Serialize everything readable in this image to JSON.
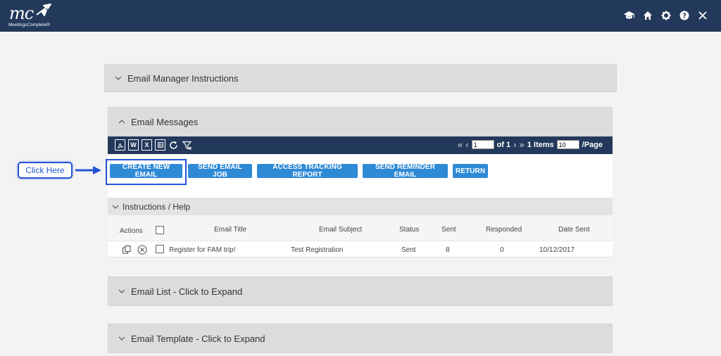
{
  "brand": {
    "logo_text": "mc",
    "logo_subtitle": "MeetingsComplete®"
  },
  "topbar_icons": [
    "graduation-cap-icon",
    "home-icon",
    "gear-icon",
    "help-icon",
    "close-icon"
  ],
  "colors": {
    "header_bg": "#23395b",
    "button_blue": "#2f8ad6",
    "callout_blue": "#2453d6",
    "panel_grey": "#dcdcdc"
  },
  "panels": {
    "instructions": "Email Manager Instructions",
    "messages": "Email Messages",
    "email_list": "Email List - Click to Expand",
    "template": "Email Template - Click to Expand",
    "help": "Instructions / Help"
  },
  "toolbar": {
    "icons": [
      "pdf-icon",
      "word-icon",
      "excel-icon",
      "csv-icon",
      "refresh-icon",
      "clear-filter-icon"
    ],
    "pager": {
      "page_value": "1",
      "of_label": "of 1",
      "items_label": "1 Items",
      "page_size": "10",
      "per_page_label": "/Page"
    }
  },
  "buttons": {
    "create": "CREATE NEW EMAIL",
    "send_job": "SEND EMAIL JOB",
    "tracking": "ACCESS TRACKING REPORT",
    "reminder": "SEND REMINDER EMAIL",
    "return": "RETURN"
  },
  "callout": {
    "label": "Click Here"
  },
  "table": {
    "headers": {
      "actions": "Actions",
      "title": "Email Title",
      "subject": "Email Subject",
      "status": "Status",
      "sent": "Sent",
      "responded": "Responded",
      "date": "Date Sent"
    },
    "rows": [
      {
        "title": "Register for FAM trip!",
        "subject": "Test Registration",
        "status": "Sent",
        "sent": "8",
        "responded": "0",
        "date": "10/12/2017"
      }
    ]
  }
}
